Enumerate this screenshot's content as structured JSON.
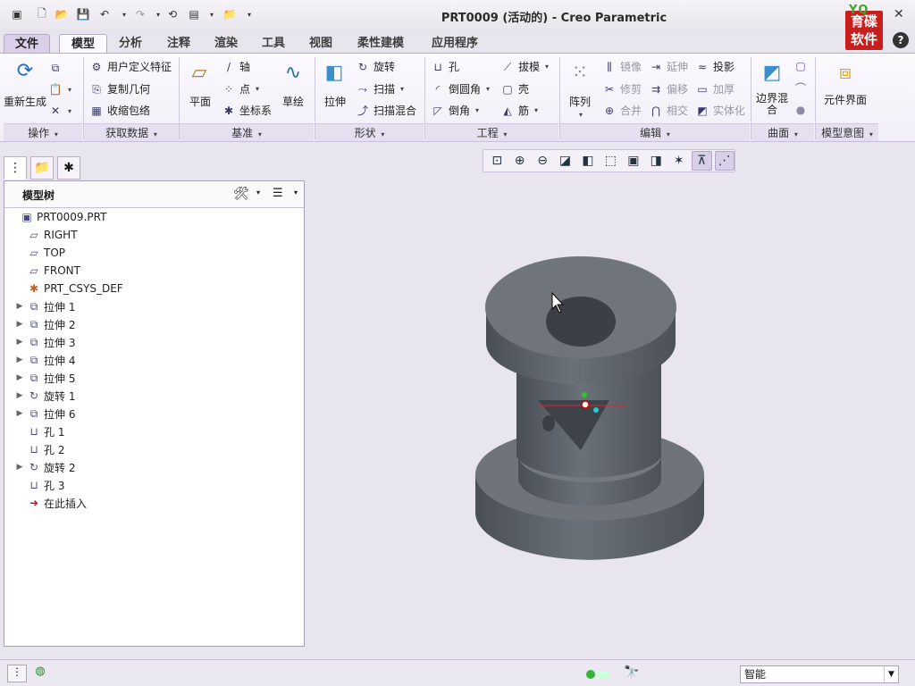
{
  "window": {
    "title": "PRT0009 (活动的) - Creo Parametric"
  },
  "logo": {
    "text_top": "YQ",
    "line1": "育碟",
    "line2": "软件"
  },
  "tabs": [
    "文件",
    "模型",
    "分析",
    "注释",
    "渲染",
    "工具",
    "视图",
    "柔性建模",
    "应用程序"
  ],
  "ribbon": {
    "regen": "重新生成",
    "get_data": [
      "用户定义特征",
      "复制几何",
      "收缩包络"
    ],
    "datum": {
      "plane": "平面",
      "axis": "轴",
      "point": "点",
      "csys": "坐标系",
      "sketch": "草绘"
    },
    "shapes": {
      "extrude": "拉伸",
      "revolve": "旋转",
      "sweep": "扫描",
      "swept_blend": "扫描混合"
    },
    "engineering": {
      "hole": "孔",
      "round": "倒圆角",
      "chamfer": "倒角",
      "draft": "拔模",
      "shell": "壳",
      "rib": "筋"
    },
    "editing": {
      "pattern": "阵列",
      "mirror": "镜像",
      "trim": "修剪",
      "merge": "合并",
      "extend": "延伸",
      "offset": "偏移",
      "intersect": "相交",
      "project": "投影",
      "thicken": "加厚",
      "solidify": "实体化"
    },
    "surfaces": {
      "boundary_blend": "边界混合"
    },
    "intent": {
      "component_interface": "元件界面"
    },
    "groups": [
      "操作",
      "获取数据",
      "基准",
      "形状",
      "工程",
      "编辑",
      "曲面",
      "模型意图"
    ]
  },
  "model_tree": {
    "header": "模型树",
    "items": [
      {
        "label": "PRT0009.PRT",
        "icon": "part-icon",
        "expandable": false,
        "indent": 0
      },
      {
        "label": "RIGHT",
        "icon": "datum-plane-icon",
        "expandable": false,
        "indent": 1
      },
      {
        "label": "TOP",
        "icon": "datum-plane-icon",
        "expandable": false,
        "indent": 1
      },
      {
        "label": "FRONT",
        "icon": "datum-plane-icon",
        "expandable": false,
        "indent": 1
      },
      {
        "label": "PRT_CSYS_DEF",
        "icon": "csys-icon",
        "expandable": false,
        "indent": 1
      },
      {
        "label": "拉伸 1",
        "icon": "extrude-icon",
        "expandable": true,
        "indent": 1
      },
      {
        "label": "拉伸 2",
        "icon": "extrude-icon",
        "expandable": true,
        "indent": 1
      },
      {
        "label": "拉伸 3",
        "icon": "extrude-icon",
        "expandable": true,
        "indent": 1
      },
      {
        "label": "拉伸 4",
        "icon": "extrude-icon",
        "expandable": true,
        "indent": 1
      },
      {
        "label": "拉伸 5",
        "icon": "extrude-icon",
        "expandable": true,
        "indent": 1
      },
      {
        "label": "旋转 1",
        "icon": "revolve-icon",
        "expandable": true,
        "indent": 1
      },
      {
        "label": "拉伸 6",
        "icon": "extrude-icon",
        "expandable": true,
        "indent": 1
      },
      {
        "label": "孔 1",
        "icon": "hole-icon",
        "expandable": false,
        "indent": 1
      },
      {
        "label": "孔 2",
        "icon": "hole-icon",
        "expandable": false,
        "indent": 1
      },
      {
        "label": "旋转 2",
        "icon": "revolve-icon",
        "expandable": true,
        "indent": 1
      },
      {
        "label": "孔 3",
        "icon": "hole-icon",
        "expandable": false,
        "indent": 1
      },
      {
        "label": "在此插入",
        "icon": "insert-here-icon",
        "expandable": false,
        "indent": 1
      }
    ]
  },
  "status": {
    "filter": "智能"
  },
  "colors": {
    "accent": "#6b5a8e",
    "bg": "#e9e5ee",
    "model": "#5d636b"
  }
}
